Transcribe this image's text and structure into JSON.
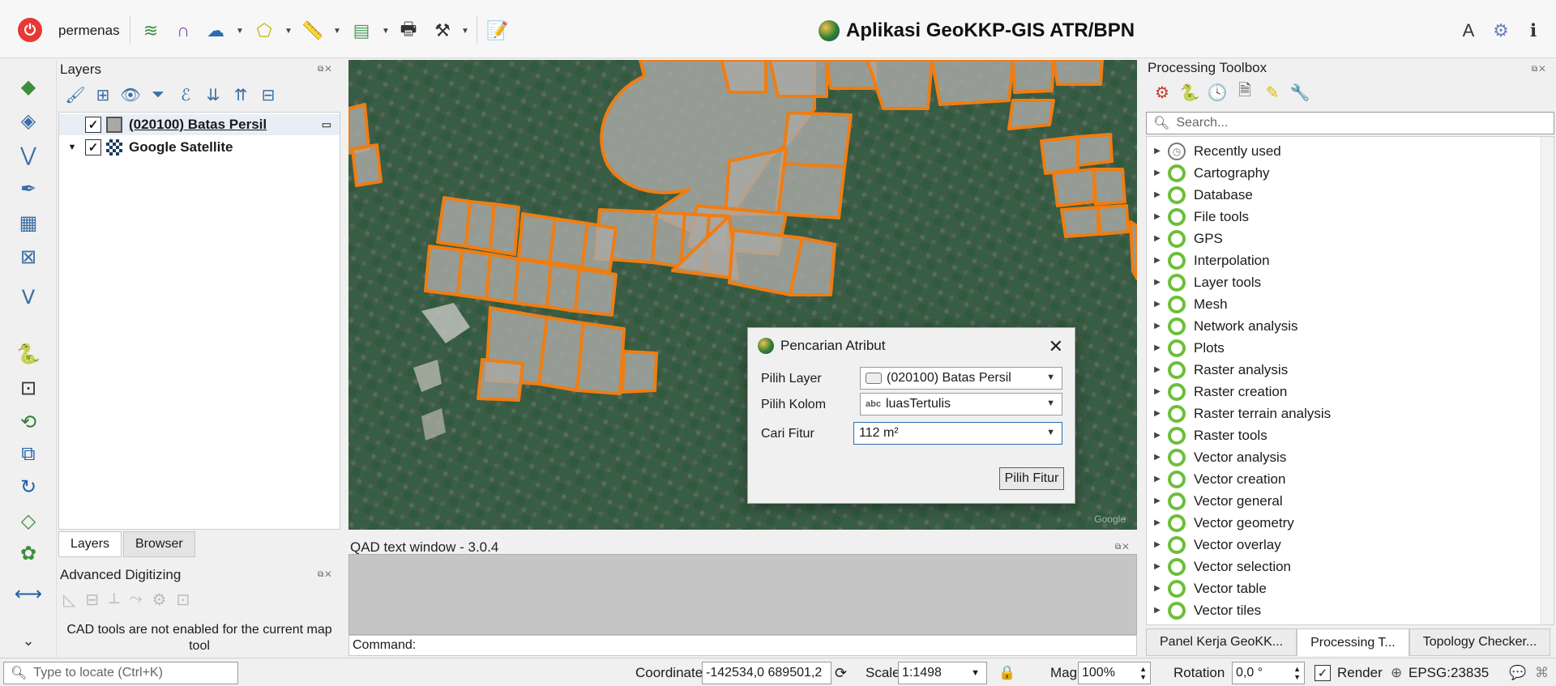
{
  "topbar": {
    "username": "permenas",
    "title": "Aplikasi GeoKKP-GIS ATR/BPN"
  },
  "layers": {
    "panel_title": "Layers",
    "items": [
      {
        "name": "(020100) Batas Persil",
        "checked": true
      },
      {
        "name": "Google Satellite",
        "checked": true
      }
    ],
    "tabs": [
      "Layers",
      "Browser"
    ]
  },
  "advanced_digitizing": {
    "title": "Advanced Digitizing",
    "message": "CAD tools are not enabled for the current map tool"
  },
  "dialog": {
    "title": "Pencarian Atribut",
    "fields": [
      {
        "label": "Pilih Layer",
        "value": "(020100) Batas Persil"
      },
      {
        "label": "Pilih Kolom",
        "type_badge": "abc",
        "value": "luasTertulis"
      },
      {
        "label": "Cari Fitur",
        "value": "112 m²"
      }
    ],
    "button": "Pilih Fitur"
  },
  "qad": {
    "title": "QAD text window - 3.0.4",
    "command_label": "Command:"
  },
  "processing": {
    "title": "Processing Toolbox",
    "search_placeholder": "Search...",
    "items": [
      "Recently used",
      "Cartography",
      "Database",
      "File tools",
      "GPS",
      "Interpolation",
      "Layer tools",
      "Mesh",
      "Network analysis",
      "Plots",
      "Raster analysis",
      "Raster creation",
      "Raster terrain analysis",
      "Raster tools",
      "Vector analysis",
      "Vector creation",
      "Vector general",
      "Vector geometry",
      "Vector overlay",
      "Vector selection",
      "Vector table",
      "Vector tiles"
    ],
    "tabs": [
      "Panel Kerja GeoKK...",
      "Processing T...",
      "Topology Checker..."
    ]
  },
  "status": {
    "locate_placeholder": "Type to locate (Ctrl+K)",
    "coordinate_label": "Coordinate",
    "coordinate_value": "-142534,0 689501,2",
    "scale_label": "Scale",
    "scale_value": "1:1498",
    "magnifier_label": "Magnifier",
    "magnifier_value": "100%",
    "rotation_label": "Rotation",
    "rotation_value": "0,0 °",
    "render_label": "Render",
    "crs": "EPSG:23835"
  },
  "colors": {
    "parcel_outline": "#f07d12",
    "parcel_fill": "#a9aaa6",
    "accent": "#2b6cb0"
  },
  "icons": [
    "power-icon",
    "layer-stack-icon",
    "digitize-icon",
    "cloud-download-icon",
    "polygon-icon",
    "ruler-icon",
    "map-export-icon",
    "print-icon",
    "hammer-icon",
    "notepad-icon",
    "text-annotation-icon",
    "settings-gear-icon",
    "close-icon",
    "search-icon",
    "python-icon",
    "lock-icon",
    "message-icon"
  ]
}
